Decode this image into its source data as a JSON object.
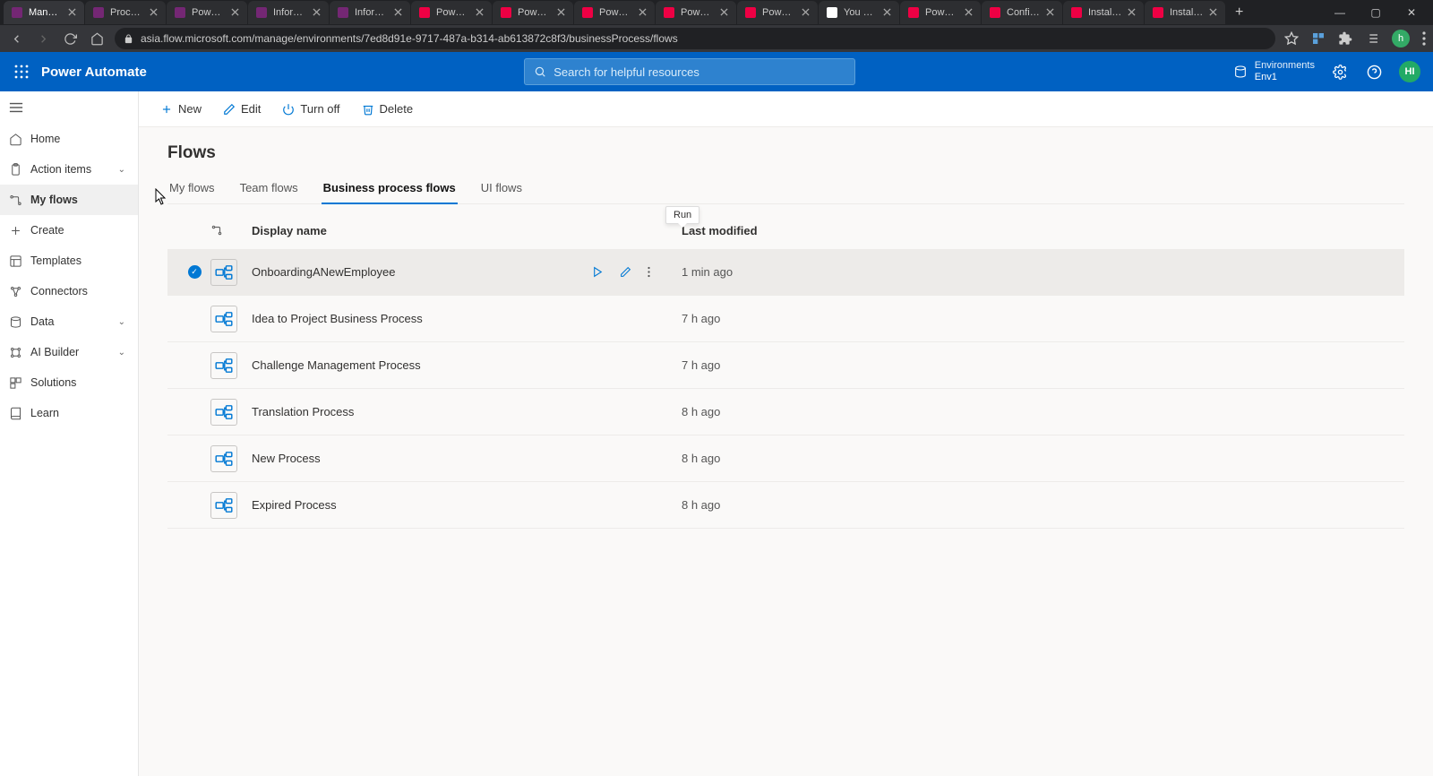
{
  "browser": {
    "tabs": [
      {
        "title": "Manage",
        "active": true
      },
      {
        "title": "Process",
        "active": false
      },
      {
        "title": "Power A",
        "active": false
      },
      {
        "title": "Informat",
        "active": false
      },
      {
        "title": "Informat",
        "active": false
      },
      {
        "title": "Power Pl",
        "active": false
      },
      {
        "title": "Power Pl",
        "active": false
      },
      {
        "title": "Power Pl",
        "active": false
      },
      {
        "title": "Power Pl",
        "active": false
      },
      {
        "title": "Power Pl",
        "active": false
      },
      {
        "title": "You do n",
        "active": false
      },
      {
        "title": "Power Pl",
        "active": false
      },
      {
        "title": "Configur",
        "active": false
      },
      {
        "title": "Install an",
        "active": false
      },
      {
        "title": "Install an",
        "active": false
      }
    ],
    "url": "asia.flow.microsoft.com/manage/environments/7ed8d91e-9717-487a-b314-ab613872c8f3/businessProcess/flows",
    "avatar": "h"
  },
  "suite": {
    "appName": "Power Automate",
    "searchPlaceholder": "Search for helpful resources",
    "envLabel": "Environments",
    "envName": "Env1",
    "userInitials": "HI"
  },
  "sidebar": {
    "items": [
      {
        "label": "Home",
        "icon": "home-icon"
      },
      {
        "label": "Action items",
        "icon": "clipboard-icon",
        "chevron": true
      },
      {
        "label": "My flows",
        "icon": "flow-icon",
        "selected": true
      },
      {
        "label": "Create",
        "icon": "plus-icon"
      },
      {
        "label": "Templates",
        "icon": "template-icon"
      },
      {
        "label": "Connectors",
        "icon": "connector-icon"
      },
      {
        "label": "Data",
        "icon": "data-icon",
        "chevron": true
      },
      {
        "label": "AI Builder",
        "icon": "ai-icon",
        "chevron": true
      },
      {
        "label": "Solutions",
        "icon": "solutions-icon"
      },
      {
        "label": "Learn",
        "icon": "learn-icon"
      }
    ]
  },
  "commands": {
    "new": "New",
    "edit": "Edit",
    "turnOff": "Turn off",
    "delete": "Delete"
  },
  "page": {
    "title": "Flows",
    "tabs": [
      "My flows",
      "Team flows",
      "Business process flows",
      "UI flows"
    ],
    "activeTab": 2,
    "tooltip": "Run"
  },
  "table": {
    "headers": {
      "name": "Display name",
      "modified": "Last modified"
    },
    "rows": [
      {
        "name": "OnboardingANewEmployee",
        "modified": "1 min ago",
        "selected": true,
        "showActions": true
      },
      {
        "name": "Idea to Project Business Process",
        "modified": "7 h ago"
      },
      {
        "name": "Challenge Management Process",
        "modified": "7 h ago"
      },
      {
        "name": "Translation Process",
        "modified": "8 h ago"
      },
      {
        "name": "New Process",
        "modified": "8 h ago"
      },
      {
        "name": "Expired Process",
        "modified": "8 h ago"
      }
    ]
  }
}
